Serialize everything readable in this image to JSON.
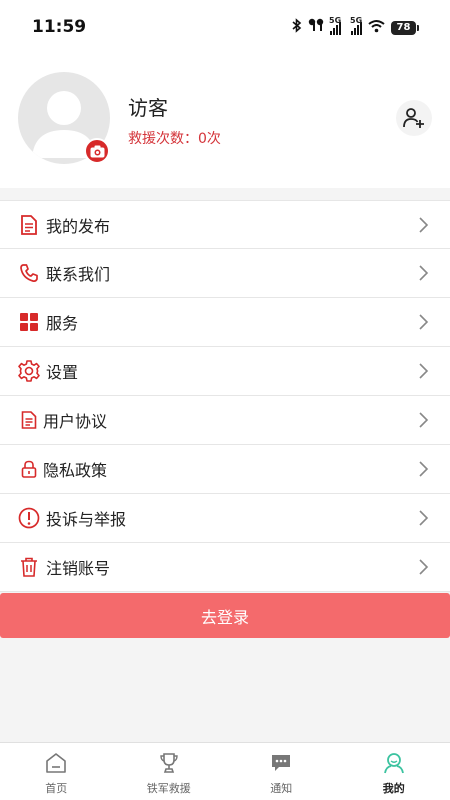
{
  "status_bar": {
    "time": "11:59",
    "battery": "78",
    "signal_labels": [
      "5G",
      "5G"
    ],
    "icons": [
      "bluetooth-icon",
      "earbuds-icon",
      "signal-icon",
      "signal-icon",
      "wifi-icon",
      "battery-icon"
    ]
  },
  "profile": {
    "name": "访客",
    "rescue_count": "救援次数：0次",
    "avatar_icon": "default-avatar-icon",
    "camera_icon": "camera-icon",
    "add_friend_icon": "add-user-icon"
  },
  "menu": {
    "items": [
      {
        "label": "我的发布",
        "icon": "document-icon"
      },
      {
        "label": "联系我们",
        "icon": "phone-icon"
      },
      {
        "label": "服务",
        "icon": "grid-icon"
      },
      {
        "label": "设置",
        "icon": "gear-icon"
      },
      {
        "label": "用户协议",
        "icon": "agreement-icon"
      },
      {
        "label": "隐私政策",
        "icon": "lock-icon"
      },
      {
        "label": "投诉与举报",
        "icon": "alert-icon"
      },
      {
        "label": "注销账号",
        "icon": "trash-icon"
      }
    ]
  },
  "login_button": "去登录",
  "bottom_nav": {
    "items": [
      {
        "label": "首页",
        "icon": "home-icon"
      },
      {
        "label": "铁军救援",
        "icon": "trophy-icon"
      },
      {
        "label": "通知",
        "icon": "message-icon"
      },
      {
        "label": "我的",
        "icon": "profile-icon"
      }
    ],
    "active": "我的"
  },
  "colors": {
    "accent_red": "#d72a2a",
    "login_button": "#f46a6c",
    "active_nav": "#3cc3a0"
  }
}
